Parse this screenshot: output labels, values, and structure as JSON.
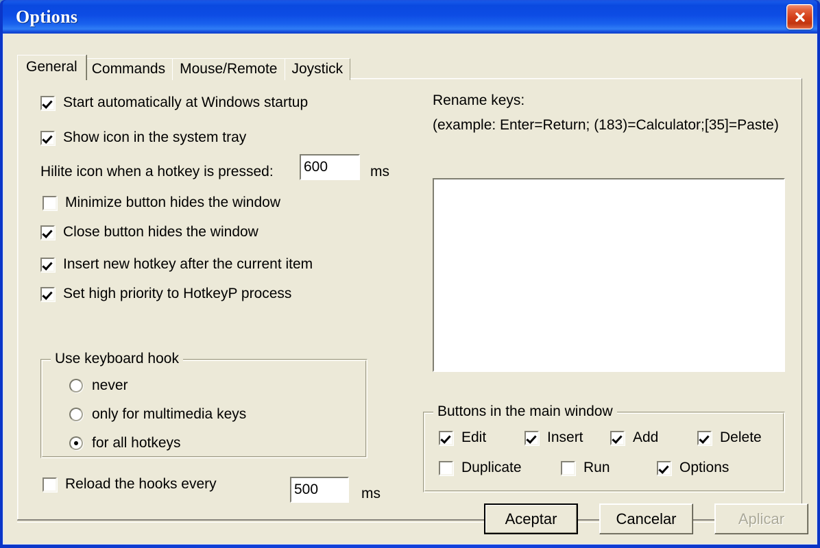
{
  "window": {
    "title": "Options",
    "close_icon": "close-icon"
  },
  "tabs": [
    {
      "label": "General",
      "active": true
    },
    {
      "label": "Commands",
      "active": false
    },
    {
      "label": "Mouse/Remote",
      "active": false
    },
    {
      "label": "Joystick",
      "active": false
    }
  ],
  "general": {
    "checkboxes": [
      {
        "label": "Start automatically at Windows startup",
        "checked": true
      },
      {
        "label": "Show icon in the system tray",
        "checked": true
      },
      {
        "label": "Minimize button hides the window",
        "checked": false
      },
      {
        "label": "Close button hides the window",
        "checked": true
      },
      {
        "label": "Insert new hotkey after the current item",
        "checked": true
      },
      {
        "label": "Set high priority to HotkeyP process",
        "checked": true
      }
    ],
    "hilite": {
      "label": "Hilite icon when a hotkey is pressed:",
      "value": "600",
      "unit": "ms"
    },
    "keyboard_hook": {
      "title": "Use keyboard hook",
      "options": [
        {
          "label": "never",
          "selected": false
        },
        {
          "label": "only for multimedia keys",
          "selected": false
        },
        {
          "label": "for all hotkeys",
          "selected": true
        }
      ]
    },
    "reload": {
      "label": "Reload the hooks every",
      "checked": false,
      "value": "500",
      "unit": "ms"
    },
    "rename_keys": {
      "title": "Rename keys:",
      "example": "(example:  Enter=Return; (183)=Calculator;[35]=Paste)",
      "value": ""
    },
    "main_buttons": {
      "title": "Buttons in the main window",
      "items": [
        {
          "label": "Edit",
          "checked": true
        },
        {
          "label": "Insert",
          "checked": true
        },
        {
          "label": "Add",
          "checked": true
        },
        {
          "label": "Delete",
          "checked": true
        },
        {
          "label": "Duplicate",
          "checked": false
        },
        {
          "label": "Run",
          "checked": false
        },
        {
          "label": "Options",
          "checked": true
        }
      ]
    }
  },
  "footer": {
    "ok_label": "Aceptar",
    "cancel_label": "Cancelar",
    "apply_label": "Aplicar",
    "apply_disabled": true
  },
  "colors": {
    "titlebar_blue": "#0d4ce4",
    "dialog_face": "#ece9d8",
    "close_red": "#d23c17",
    "field_white": "#ffffff"
  }
}
